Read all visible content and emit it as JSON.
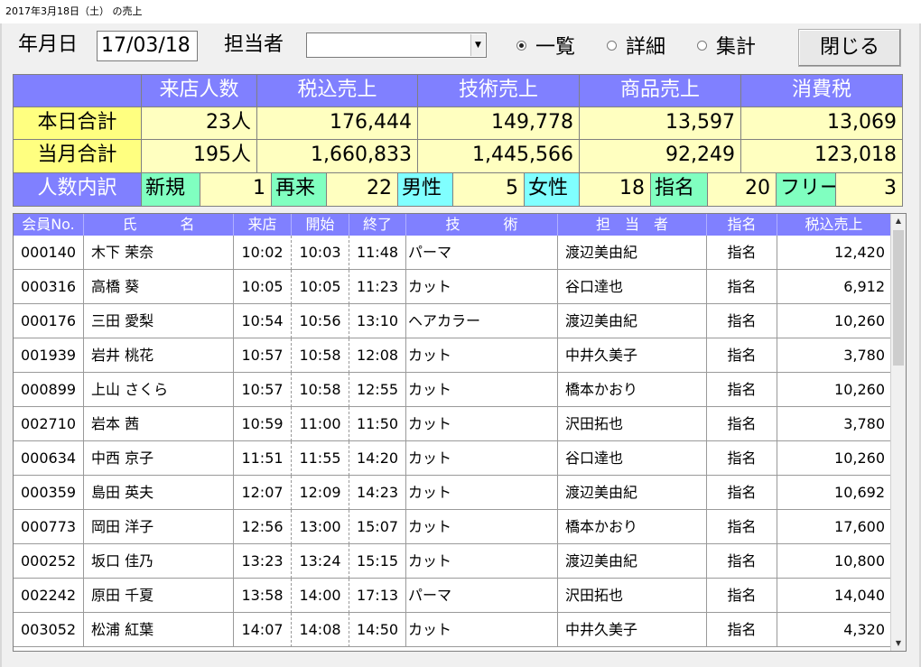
{
  "window": {
    "title": "2017年3月18日（土） の売上"
  },
  "toolbar": {
    "date_label": "年月日",
    "date_value": "17/03/18",
    "staff_label": "担当者",
    "staff_value": "",
    "radios": [
      {
        "label": "一覧",
        "checked": true
      },
      {
        "label": "詳細",
        "checked": false
      },
      {
        "label": "集計",
        "checked": false
      }
    ],
    "close_label": "閉じる"
  },
  "summary": {
    "headers": [
      "来店人数",
      "税込売上",
      "技術売上",
      "商品売上",
      "消費税"
    ],
    "rows": [
      {
        "label": "本日合計",
        "values": [
          "23人",
          "176,444",
          "149,778",
          "13,597",
          "13,069"
        ]
      },
      {
        "label": "当月合計",
        "values": [
          "195人",
          "1,660,833",
          "1,445,566",
          "92,249",
          "123,018"
        ]
      }
    ],
    "breakdown": {
      "label": "人数内訳",
      "items": [
        {
          "label": "新規",
          "value": "1"
        },
        {
          "label": "再来",
          "value": "22"
        },
        {
          "label": "男性",
          "value": "5"
        },
        {
          "label": "女性",
          "value": "18"
        },
        {
          "label": "指名",
          "value": "20"
        },
        {
          "label": "フリー",
          "value": "3"
        }
      ]
    }
  },
  "list": {
    "columns": [
      "会員No.",
      "氏　　　名",
      "来店",
      "開始",
      "終了",
      "技　　　術",
      "担　当　者",
      "指名",
      "税込売上"
    ],
    "rows": [
      [
        "000140",
        "木下 茉奈",
        "10:02",
        "10:03",
        "11:48",
        "パーマ",
        "渡辺美由紀",
        "指名",
        "12,420"
      ],
      [
        "000316",
        "高橋 葵",
        "10:05",
        "10:05",
        "11:23",
        "カット",
        "谷口達也",
        "指名",
        "6,912"
      ],
      [
        "000176",
        "三田 愛梨",
        "10:54",
        "10:56",
        "13:10",
        "ヘアカラー",
        "渡辺美由紀",
        "指名",
        "10,260"
      ],
      [
        "001939",
        "岩井 桃花",
        "10:57",
        "10:58",
        "12:08",
        "カット",
        "中井久美子",
        "指名",
        "3,780"
      ],
      [
        "000899",
        "上山 さくら",
        "10:57",
        "10:58",
        "12:55",
        "カット",
        "橋本かおり",
        "指名",
        "10,260"
      ],
      [
        "002710",
        "岩本 茜",
        "10:59",
        "11:00",
        "11:50",
        "カット",
        "沢田拓也",
        "指名",
        "3,780"
      ],
      [
        "000634",
        "中西 京子",
        "11:51",
        "11:55",
        "14:20",
        "カット",
        "谷口達也",
        "指名",
        "10,260"
      ],
      [
        "000359",
        "島田 英夫",
        "12:07",
        "12:09",
        "14:23",
        "カット",
        "渡辺美由紀",
        "指名",
        "10,692"
      ],
      [
        "000773",
        "岡田 洋子",
        "12:56",
        "13:00",
        "15:07",
        "カット",
        "橋本かおり",
        "指名",
        "17,600"
      ],
      [
        "000252",
        "坂口 佳乃",
        "13:23",
        "13:24",
        "15:15",
        "カット",
        "渡辺美由紀",
        "指名",
        "10,800"
      ],
      [
        "002242",
        "原田 千夏",
        "13:58",
        "14:00",
        "17:13",
        "パーマ",
        "沢田拓也",
        "指名",
        "14,040"
      ],
      [
        "003052",
        "松浦 紅葉",
        "14:07",
        "14:08",
        "14:50",
        "カット",
        "中井久美子",
        "指名",
        "4,320"
      ]
    ]
  },
  "icons": {
    "combo_arrow": "chevron-down-icon",
    "scroll_up": "chevron-up-icon",
    "scroll_down": "chevron-down-icon"
  },
  "colors": {
    "header_blue": "#8080ff",
    "label_yellow": "#ffff80",
    "value_yellow": "#ffffc0",
    "label_green": "#80ffc0",
    "label_cyan": "#80ffff"
  }
}
